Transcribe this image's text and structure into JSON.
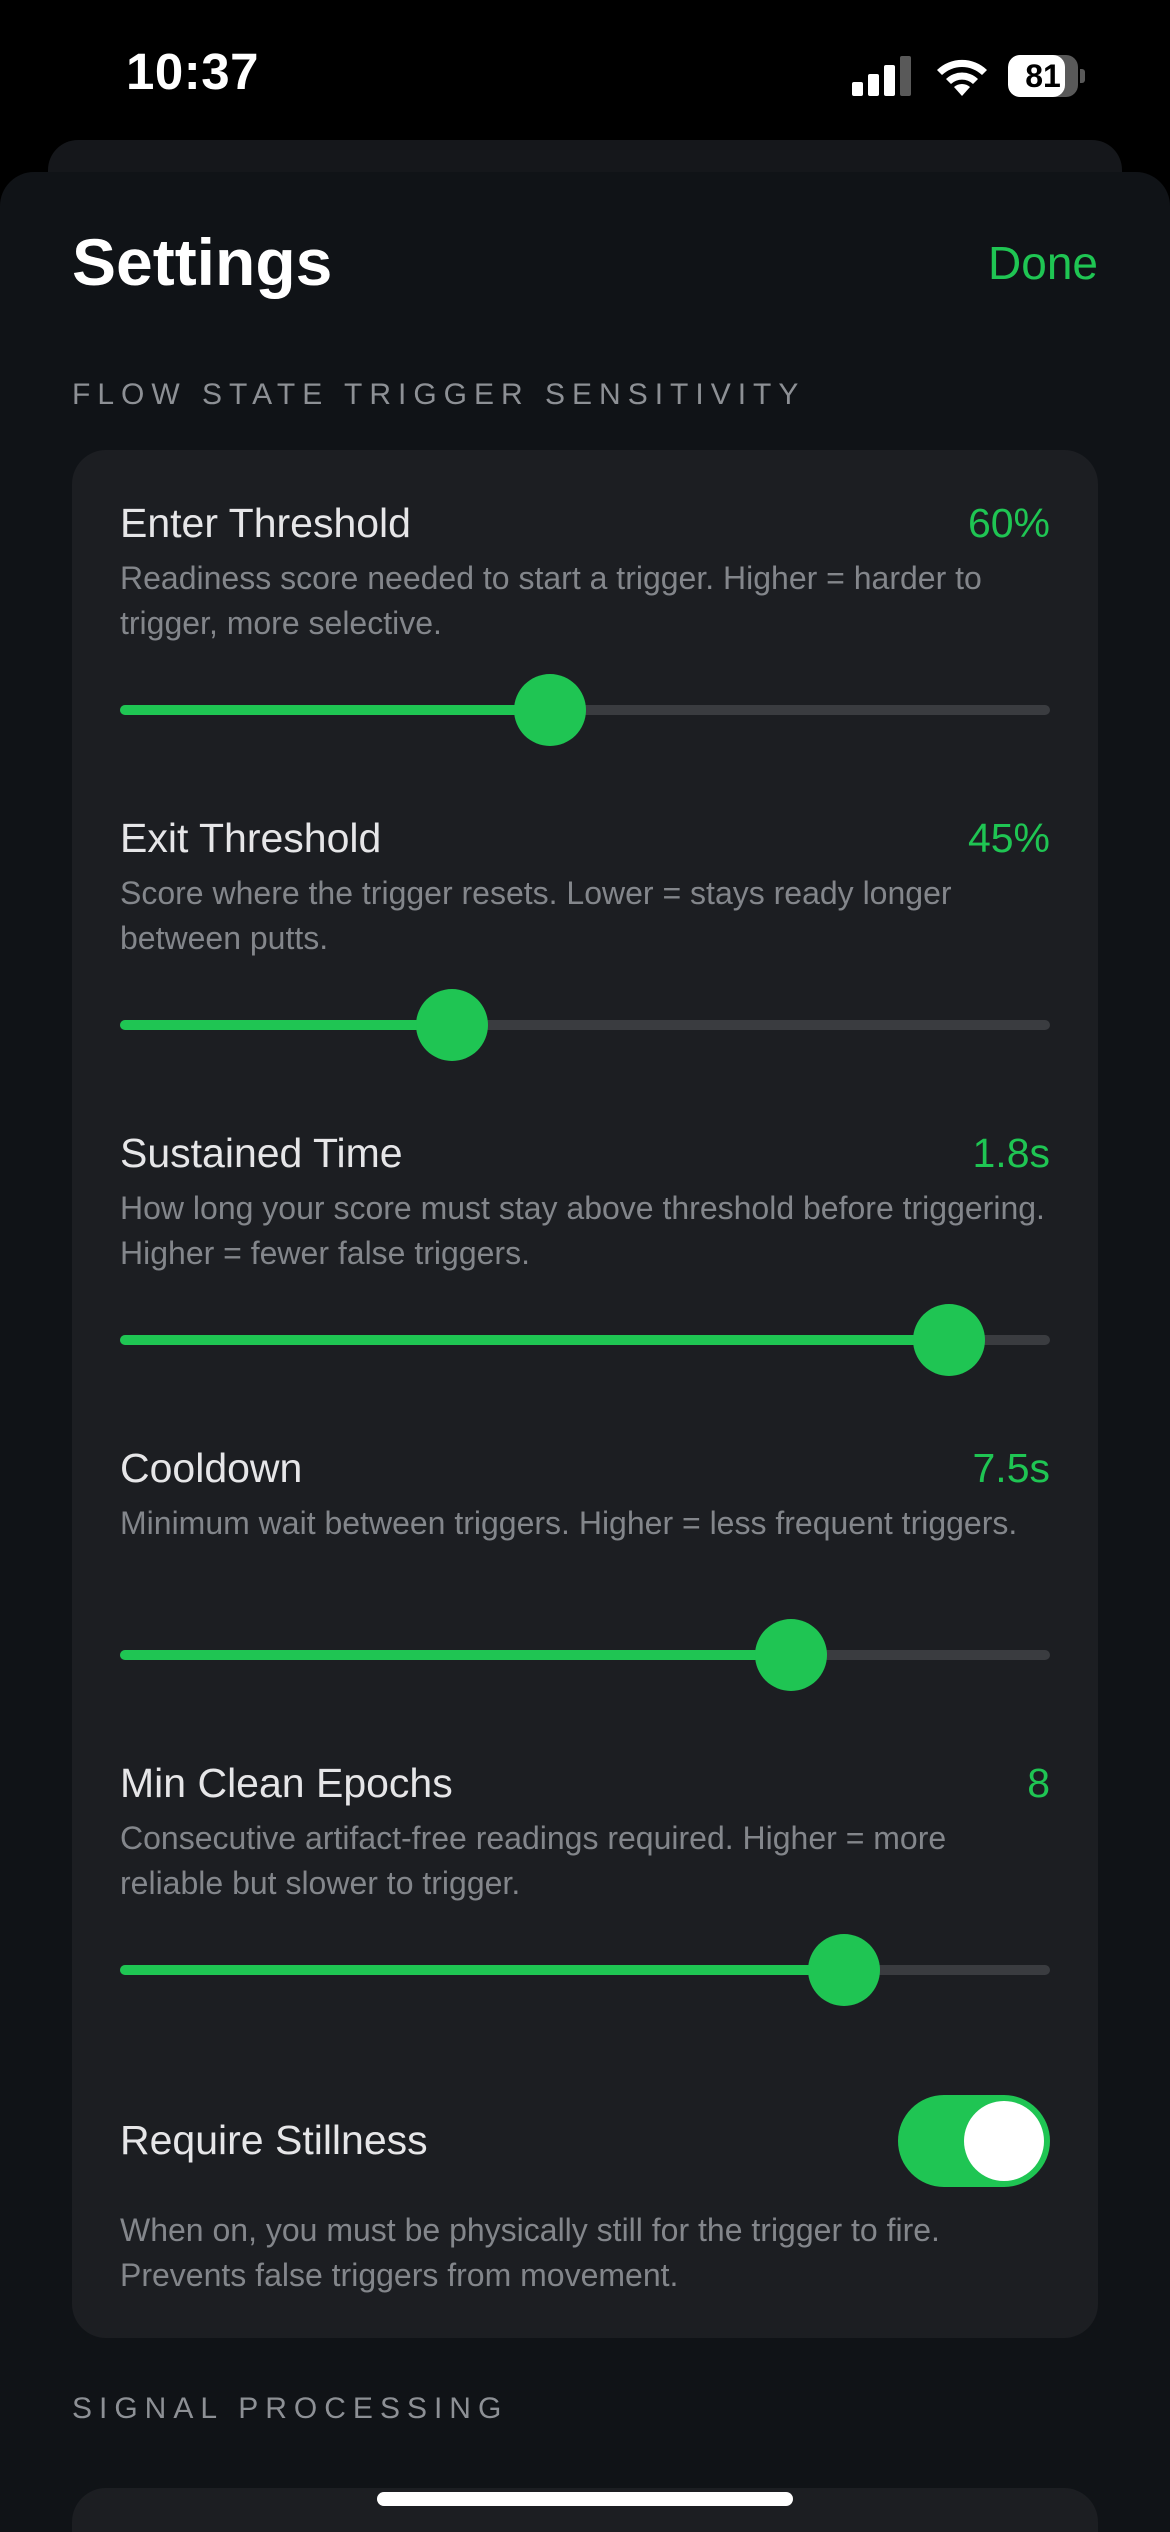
{
  "status_bar": {
    "time": "10:37",
    "battery_level": "81",
    "icons": [
      "signal-icon",
      "wifi-icon",
      "battery-icon"
    ]
  },
  "header": {
    "title": "Settings",
    "done_label": "Done"
  },
  "sections": {
    "trigger": {
      "title": "FLOW STATE TRIGGER SENSITIVITY",
      "sliders": [
        {
          "label": "Enter Threshold",
          "value": "60%",
          "description": "Readiness score needed to start a trigger. Higher = harder to trigger, more selective.",
          "fraction": 0.462
        },
        {
          "label": "Exit Threshold",
          "value": "45%",
          "description": "Score where the trigger resets. Lower = stays ready longer between putts.",
          "fraction": 0.357
        },
        {
          "label": "Sustained Time",
          "value": "1.8s",
          "description": "How long your score must stay above threshold before triggering. Higher = fewer false triggers.",
          "fraction": 0.891
        },
        {
          "label": "Cooldown",
          "value": "7.5s",
          "description": "Minimum wait between triggers. Higher = less frequent triggers.",
          "fraction": 0.722
        },
        {
          "label": "Min Clean Epochs",
          "value": "8",
          "description": "Consecutive artifact-free readings required. Higher = more reliable but slower to trigger.",
          "fraction": 0.778
        }
      ],
      "toggle": {
        "label": "Require Stillness",
        "on": true,
        "description": "When on, you must be physically still for the trigger to fire. Prevents false triggers from movement."
      }
    },
    "signal": {
      "title": "SIGNAL PROCESSING"
    }
  },
  "colors": {
    "accent": "#1fc553",
    "background": "#101317",
    "card": "#1c1e22",
    "secondary_text": "#83868b"
  }
}
